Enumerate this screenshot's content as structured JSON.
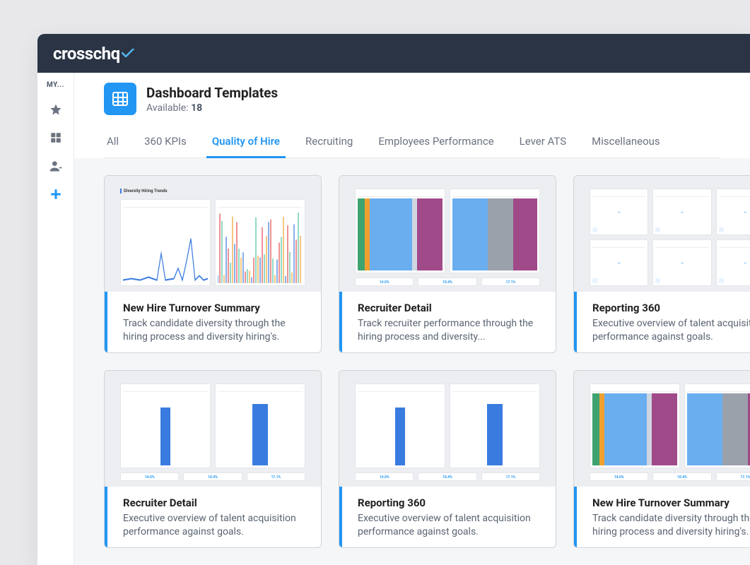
{
  "brand": "crosschq",
  "sidebar": {
    "label": "MY..."
  },
  "header": {
    "title": "Dashboard Templates",
    "available_label": "Available:",
    "available_count": "18"
  },
  "tabs": [
    {
      "label": "All",
      "active": false
    },
    {
      "label": "360 KPIs",
      "active": false
    },
    {
      "label": "Quality of Hire",
      "active": true
    },
    {
      "label": "Recruiting",
      "active": false
    },
    {
      "label": "Employees Performance",
      "active": false
    },
    {
      "label": "Lever ATS",
      "active": false
    },
    {
      "label": "Miscellaneous",
      "active": false
    }
  ],
  "cards": [
    {
      "title": "New Hire Turnover Summary",
      "desc": "Track candidate diversity through the hiring process and diversity hiring's.",
      "preview": "linecharts"
    },
    {
      "title": "Recruiter Detail",
      "desc": "Track recruiter performance through the hiring process and diversity...",
      "preview": "stacked"
    },
    {
      "title": "Reporting 360",
      "desc": "Executive overview of talent acquisition performance against goals.",
      "preview": "tilegrid"
    },
    {
      "title": "Recruiter Detail",
      "desc": "Executive overview of talent acquisition performance against goals.",
      "preview": "bars"
    },
    {
      "title": "Reporting 360",
      "desc": "Executive overview of talent acquisition performance against goals.",
      "preview": "bars"
    },
    {
      "title": "New Hire Turnover Summary",
      "desc": "Track candidate diversity through the hiring process and diversity hiring's.",
      "preview": "stacked"
    }
  ],
  "preview_stats": [
    "14.0%",
    "10.4%",
    "17.1%"
  ],
  "preview_title": "Diversity Hiring Trends"
}
